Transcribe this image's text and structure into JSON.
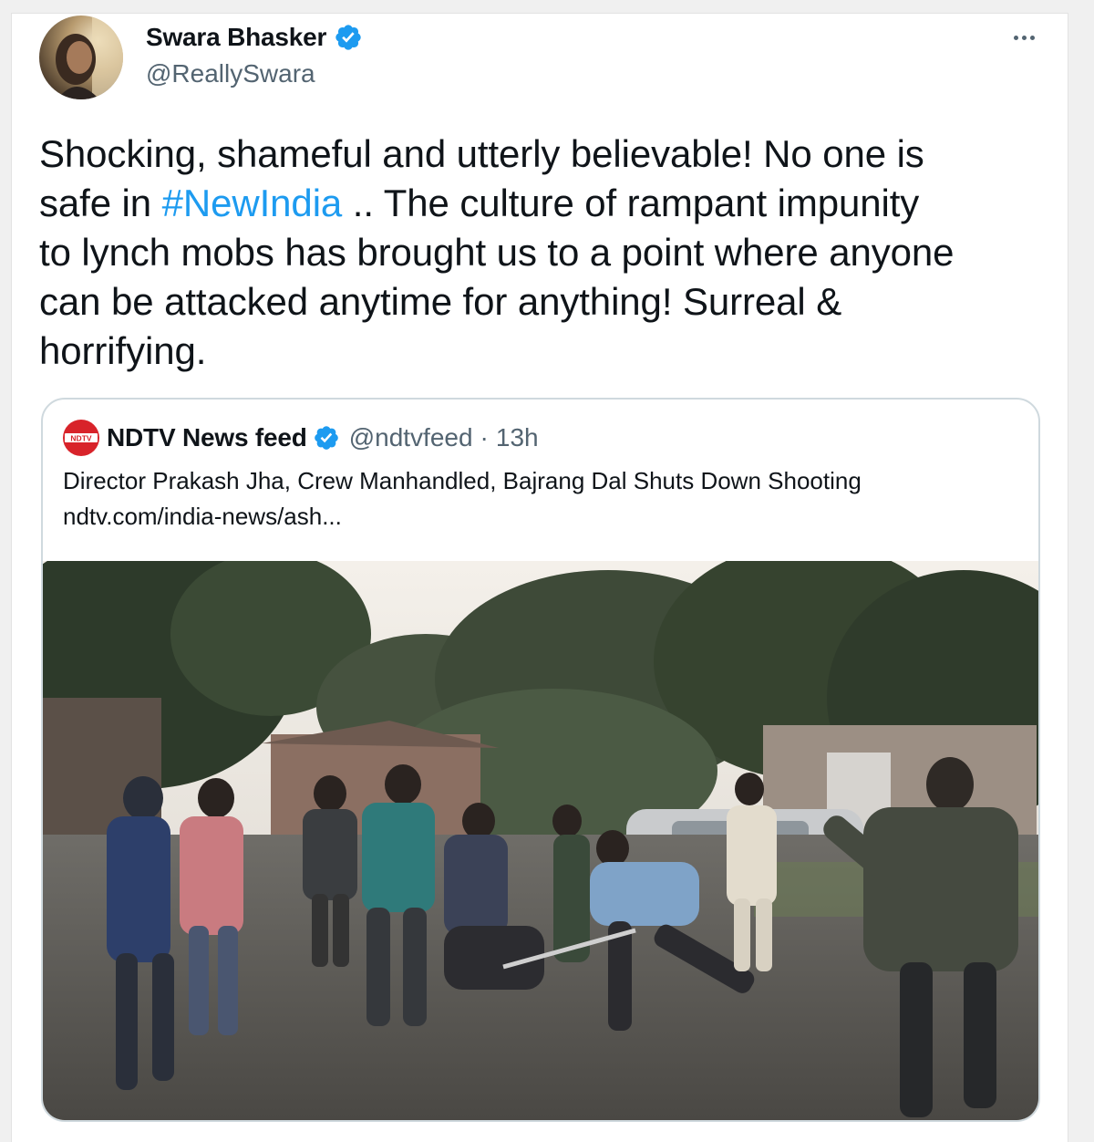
{
  "author": {
    "name": "Swara Bhasker",
    "handle": "@ReallySwara",
    "verified_icon": "verified-badge-icon",
    "avatar_icon": "avatar"
  },
  "tweet": {
    "line1": "Shocking, shameful and utterly believable! No one is",
    "line2_prefix": "safe in ",
    "hashtag": "#NewIndia",
    "line2_suffix": " .. The culture of rampant impunity",
    "line3": "to lynch mobs has brought us to a point where anyone",
    "line4": "can be attacked anytime for anything! Surreal &",
    "line5": "horrifying."
  },
  "quoted": {
    "logo_text": "NDTV",
    "name": "NDTV News feed",
    "handle": "@ndtvfeed",
    "separator": "·",
    "time": "13h",
    "headline": "Director Prakash Jha, Crew Manhandled, Bajrang Dal Shuts Down Shooting",
    "link": "ndtv.com/india-news/ash..."
  },
  "colors": {
    "accent": "#1d9bf0",
    "text": "#0f1419",
    "secondary": "#536471",
    "border": "#cfd9de",
    "ndtv_red": "#d8232a"
  }
}
